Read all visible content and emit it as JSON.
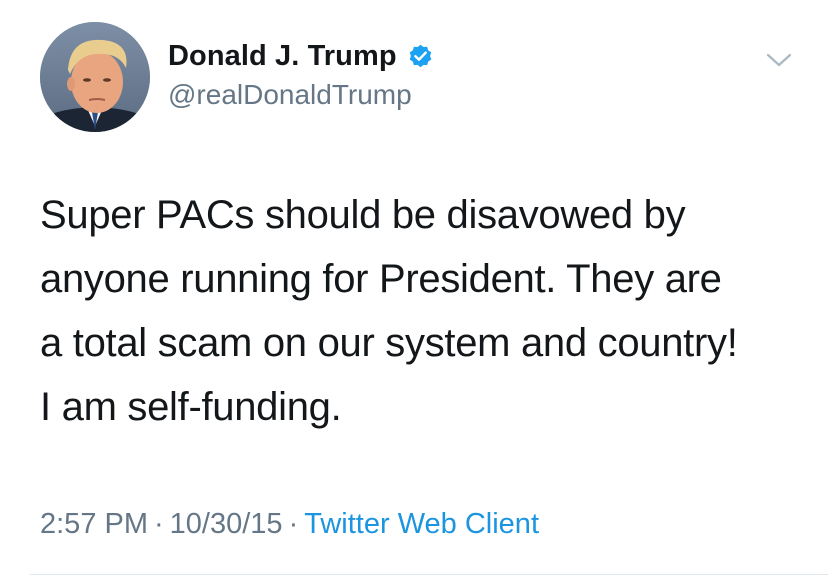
{
  "tweet": {
    "display_name": "Donald J. Trump",
    "handle": "@realDonaldTrump",
    "verified": true,
    "text": "Super PACs should be disavowed by\nanyone running for President. They are\na total scam on our system and country!\nI am self-funding.",
    "time": "2:57 PM",
    "date": "10/30/15",
    "separator": "·",
    "client": "Twitter Web Client"
  },
  "icons": {
    "verified": "verified-badge-icon",
    "menu": "chevron-down-icon"
  },
  "colors": {
    "name": "#14171a",
    "secondary": "#657786",
    "link": "#1b95e0",
    "verified": "#1da1f2"
  }
}
